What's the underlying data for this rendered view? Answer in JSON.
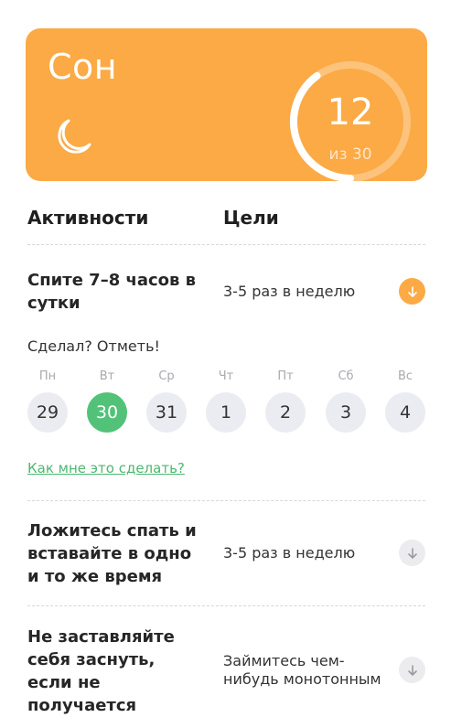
{
  "hero": {
    "title": "Сон",
    "progress_value": "12",
    "progress_total_label": "из 30",
    "progress_fraction": 0.4,
    "color": "#FBAA45",
    "icon": "moon-icon"
  },
  "columns": {
    "activities": "Активности",
    "goals": "Цели"
  },
  "activities": [
    {
      "title_lines": [
        "Спите 7–8 часов в",
        "сутки"
      ],
      "goal_lines": [
        "3-5 раз в неделю"
      ],
      "expanded": true
    },
    {
      "title_lines": [
        "Ложитесь спать и",
        "вставайте в одно",
        "и то же время"
      ],
      "goal_lines": [
        "3-5 раз в неделю"
      ],
      "expanded": false
    },
    {
      "title_lines": [
        "Не заставляйте",
        "себя заснуть,",
        "если не",
        "получается"
      ],
      "goal_lines": [
        "Займитесь чем-",
        "нибудь монотонным"
      ],
      "expanded": false
    }
  ],
  "tracker": {
    "prompt": "Сделал? Отметь!",
    "weekdays": [
      "Пн",
      "Вт",
      "Ср",
      "Чт",
      "Пт",
      "Сб",
      "Вс"
    ],
    "days": [
      "29",
      "30",
      "31",
      "1",
      "2",
      "3",
      "4"
    ],
    "selected_index": 1,
    "selected_color": "#52C279"
  },
  "link": {
    "label": "Как мне это сделать?"
  }
}
